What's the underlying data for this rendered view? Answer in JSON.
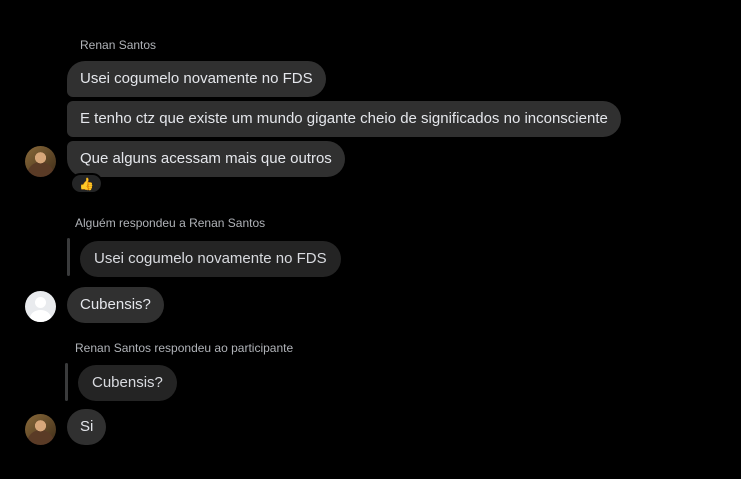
{
  "thread": {
    "sender_name": "Renan Santos",
    "messages": [
      "Usei cogumelo novamente no FDS",
      "E tenho ctz que existe um mundo gigante cheio de significados no inconsciente",
      "Que alguns acessam mais que outros"
    ],
    "reaction": "👍",
    "reply1": {
      "label": "Alguém respondeu a Renan Santos",
      "quoted": "Usei cogumelo novamente no FDS",
      "message": "Cubensis?"
    },
    "reply2": {
      "label": "Renan Santos respondeu ao participante",
      "quoted": "Cubensis?",
      "message": "Si"
    }
  },
  "colors": {
    "background": "#000000",
    "bubble": "#303030",
    "quoted_bubble": "#242424",
    "meta_text": "#b0b3b8"
  }
}
